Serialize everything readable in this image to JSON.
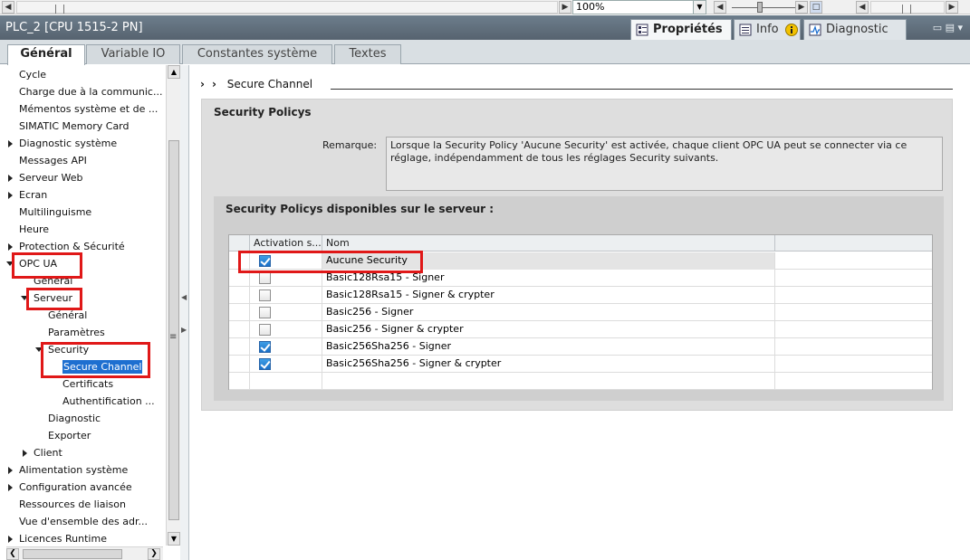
{
  "toolbar": {
    "zoom_value": "100%"
  },
  "header": {
    "device_title": "PLC_2 [CPU 1515-2 PN]",
    "inspector_tabs": [
      {
        "label": "Propriétés",
        "icon": "properties-icon",
        "active": true
      },
      {
        "label": "Info",
        "icon": "info-icon",
        "active": false
      },
      {
        "label": "Diagnostic",
        "icon": "diagnostic-icon",
        "active": false
      }
    ]
  },
  "subtabs": [
    {
      "label": "Général",
      "active": true
    },
    {
      "label": "Variable IO",
      "active": false
    },
    {
      "label": "Constantes système",
      "active": false
    },
    {
      "label": "Textes",
      "active": false
    }
  ],
  "nav": {
    "items": [
      {
        "label": "Cycle"
      },
      {
        "label": "Charge due à la communic..."
      },
      {
        "label": "Mémentos système et de ..."
      },
      {
        "label": "SIMATIC Memory Card"
      },
      {
        "label": "Diagnostic système"
      },
      {
        "label": "Messages API"
      },
      {
        "label": "Serveur Web"
      },
      {
        "label": "Ecran"
      },
      {
        "label": "Multilinguisme"
      },
      {
        "label": "Heure"
      },
      {
        "label": "Protection & Sécurité"
      },
      {
        "label": "OPC UA"
      },
      {
        "label": "Général"
      },
      {
        "label": "Serveur"
      },
      {
        "label": "Général"
      },
      {
        "label": "Paramètres"
      },
      {
        "label": "Security"
      },
      {
        "label": "Secure Channel"
      },
      {
        "label": "Certificats"
      },
      {
        "label": "Authentification ..."
      },
      {
        "label": "Diagnostic"
      },
      {
        "label": "Exporter"
      },
      {
        "label": "Client"
      },
      {
        "label": "Alimentation système"
      },
      {
        "label": "Configuration avancée"
      },
      {
        "label": "Ressources de liaison"
      },
      {
        "label": "Vue d'ensemble des adr..."
      },
      {
        "label": "Licences Runtime"
      }
    ]
  },
  "main": {
    "breadcrumb": "Secure Channel",
    "section_title": "Security Policys",
    "remark_label": "Remarque:",
    "remark_text": "Lorsque la Security Policy 'Aucune Security' est activée, chaque client OPC UA peut se connecter via ce réglage, indépendamment de tous les réglages Security suivants.",
    "sub_title": "Security Policys disponibles sur le serveur :",
    "table": {
      "columns": [
        "Activation s...",
        "Nom"
      ],
      "rows": [
        {
          "checked": true,
          "name": "Aucune Security"
        },
        {
          "checked": false,
          "name": "Basic128Rsa15 - Signer"
        },
        {
          "checked": false,
          "name": "Basic128Rsa15 - Signer & crypter"
        },
        {
          "checked": false,
          "name": "Basic256 - Signer"
        },
        {
          "checked": false,
          "name": "Basic256 - Signer & crypter"
        },
        {
          "checked": true,
          "name": "Basic256Sha256 - Signer"
        },
        {
          "checked": true,
          "name": "Basic256Sha256 - Signer & crypter"
        }
      ]
    }
  },
  "colors": {
    "titlebar": "#5f6d79",
    "selection": "#1e6fd0",
    "highlight": "#e01818"
  }
}
